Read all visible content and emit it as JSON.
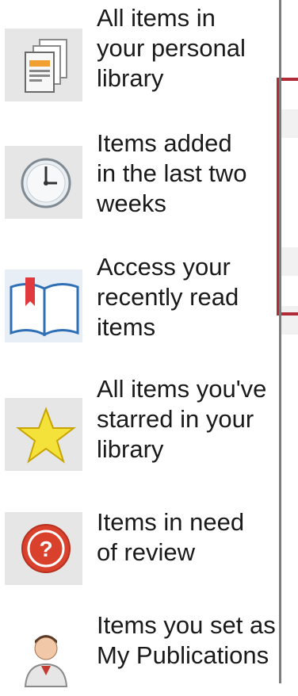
{
  "items": [
    {
      "icon": "library-books-icon",
      "text": "All items in\nyour personal\nlibrary"
    },
    {
      "icon": "clock-icon",
      "text": "Items added\nin the last two\nweeks"
    },
    {
      "icon": "open-book-icon",
      "text": "Access your\nrecently read\nitems"
    },
    {
      "icon": "star-icon",
      "text": "All items you've\nstarred in your\nlibrary"
    },
    {
      "icon": "question-icon",
      "text": "Items in need\nof review"
    },
    {
      "icon": "person-icon",
      "text": "Items you set as\nMy Publications"
    }
  ],
  "colors": {
    "highlight_border": "#b02a37",
    "divider": "#7d7d7d"
  }
}
